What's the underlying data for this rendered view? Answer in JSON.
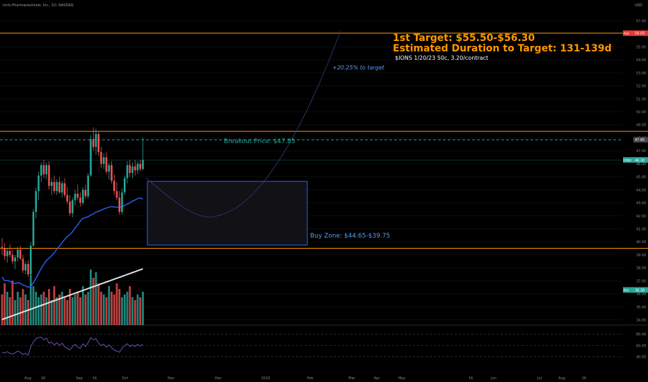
{
  "header": {
    "symbol_line": "Ionis Pharmaceuticals, Inc., 1D, NASDAQ",
    "currency": "USD"
  },
  "annotations": {
    "target_line1": "1st Target: $55.50-$56.30",
    "target_line2": "Estimated Duration to Target: 131-139d",
    "option_note": "$IONS 1/20/23 50c, 3.20/contract",
    "path_note": "+20.25% to target",
    "breakout_label": "Breakout Price: $47.85",
    "buyzone_label": "Buy Zone: $44.65-$39.75"
  },
  "price_badges": [
    {
      "text": "Ask",
      "value": "56.05",
      "price": 56.05,
      "color": "#e53935"
    },
    {
      "text": "",
      "value": "47.85",
      "price": 47.85,
      "color": "#444444"
    },
    {
      "text": "IONS",
      "value": "46.30",
      "price": 46.3,
      "color": "#26a69a"
    },
    {
      "text": "Bid",
      "value": "36.30",
      "price": 36.3,
      "color": "#26a69a"
    }
  ],
  "colors": {
    "bull": "#26a69a",
    "bear": "#ef5350",
    "level": "#ff9800",
    "ma_blue": "#2962ff",
    "ma_white": "#e0e0e0",
    "annotation_blue": "#5b9cf6",
    "breakout_green": "#26a69a"
  },
  "chart_data": {
    "type": "candlestick",
    "title": "Ionis Pharmaceuticals, Inc., 1D, NASDAQ",
    "ylim": [
      33.6,
      58.6
    ],
    "y_ticks": [
      "57.00",
      "56.00",
      "55.00",
      "54.00",
      "53.00",
      "52.00",
      "51.00",
      "50.00",
      "49.00",
      "48.00",
      "47.00",
      "46.00",
      "45.00",
      "44.00",
      "43.00",
      "42.00",
      "41.00",
      "40.00",
      "39.00",
      "38.00",
      "37.00",
      "36.00",
      "35.00",
      "34.00"
    ],
    "x_ticks": [
      "Aug",
      "16",
      "Sep",
      "16",
      "Oct",
      "Nov",
      "Dec",
      "2023",
      "Feb",
      "Mar",
      "Apr",
      "May",
      "16",
      "Jun",
      "Jul",
      "Aug",
      "16"
    ],
    "levels": [
      56.05,
      48.5,
      47.85,
      46.3,
      39.5
    ],
    "buy_zone": {
      "top": 44.65,
      "bottom": 39.75
    },
    "candles": [
      [
        39.6,
        40.3,
        39.0,
        39.5
      ],
      [
        39.5,
        39.9,
        38.6,
        38.9
      ],
      [
        38.9,
        39.5,
        38.4,
        39.3
      ],
      [
        39.3,
        39.8,
        38.8,
        39.0
      ],
      [
        39.0,
        39.4,
        38.3,
        38.5
      ],
      [
        38.5,
        39.0,
        37.9,
        38.8
      ],
      [
        38.8,
        39.6,
        38.5,
        39.4
      ],
      [
        39.4,
        39.7,
        38.6,
        38.7
      ],
      [
        38.7,
        39.0,
        37.6,
        37.8
      ],
      [
        37.8,
        38.5,
        37.5,
        38.3
      ],
      [
        38.3,
        38.6,
        37.3,
        37.5
      ],
      [
        37.5,
        40.0,
        37.3,
        39.7
      ],
      [
        39.7,
        42.5,
        39.6,
        42.3
      ],
      [
        42.3,
        44.2,
        41.8,
        43.9
      ],
      [
        43.9,
        45.4,
        43.2,
        45.1
      ],
      [
        45.1,
        46.1,
        44.6,
        45.9
      ],
      [
        45.9,
        46.3,
        44.9,
        45.2
      ],
      [
        45.2,
        46.1,
        44.8,
        45.9
      ],
      [
        45.9,
        46.2,
        44.0,
        44.3
      ],
      [
        44.3,
        44.9,
        43.6,
        44.6
      ],
      [
        44.6,
        45.1,
        43.7,
        43.9
      ],
      [
        43.9,
        44.8,
        43.6,
        44.6
      ],
      [
        44.6,
        45.0,
        43.7,
        43.8
      ],
      [
        43.8,
        44.7,
        43.4,
        44.5
      ],
      [
        44.5,
        44.9,
        43.4,
        43.6
      ],
      [
        43.6,
        44.2,
        42.9,
        43.1
      ],
      [
        43.1,
        43.6,
        42.0,
        42.2
      ],
      [
        42.2,
        43.4,
        41.9,
        43.2
      ],
      [
        43.2,
        44.0,
        42.8,
        43.7
      ],
      [
        43.7,
        44.4,
        43.2,
        43.4
      ],
      [
        43.4,
        43.8,
        42.7,
        43.0
      ],
      [
        43.0,
        44.2,
        42.8,
        44.0
      ],
      [
        44.0,
        44.4,
        43.3,
        43.5
      ],
      [
        43.5,
        45.3,
        43.3,
        45.1
      ],
      [
        45.1,
        48.2,
        45.0,
        47.9
      ],
      [
        47.9,
        48.8,
        47.0,
        47.3
      ],
      [
        47.3,
        48.7,
        46.7,
        48.3
      ],
      [
        48.3,
        48.5,
        46.6,
        46.9
      ],
      [
        46.9,
        47.3,
        45.7,
        46.0
      ],
      [
        46.0,
        46.8,
        45.6,
        46.5
      ],
      [
        46.5,
        46.9,
        45.2,
        45.4
      ],
      [
        45.4,
        46.1,
        44.8,
        45.9
      ],
      [
        45.9,
        46.2,
        44.5,
        44.7
      ],
      [
        44.7,
        45.2,
        43.6,
        43.9
      ],
      [
        43.9,
        44.6,
        43.2,
        43.4
      ],
      [
        43.4,
        43.9,
        42.1,
        42.3
      ],
      [
        42.3,
        44.1,
        42.1,
        43.8
      ],
      [
        43.8,
        45.1,
        43.6,
        44.9
      ],
      [
        44.9,
        46.2,
        44.5,
        45.9
      ],
      [
        45.9,
        46.3,
        45.0,
        45.3
      ],
      [
        45.3,
        46.1,
        44.9,
        45.8
      ],
      [
        45.8,
        46.3,
        45.1,
        45.5
      ],
      [
        45.5,
        46.2,
        45.2,
        46.0
      ],
      [
        46.0,
        46.3,
        45.4,
        45.6
      ],
      [
        45.6,
        48.0,
        45.5,
        46.3
      ]
    ],
    "volume": [
      0.55,
      0.75,
      0.6,
      0.5,
      0.8,
      0.45,
      0.6,
      0.5,
      0.65,
      0.55,
      0.45,
      0.9,
      0.7,
      0.6,
      0.5,
      0.55,
      0.6,
      0.5,
      0.65,
      0.45,
      0.7,
      0.5,
      0.55,
      0.6,
      0.5,
      0.45,
      0.65,
      0.5,
      0.55,
      0.6,
      0.5,
      0.7,
      0.55,
      0.6,
      1.0,
      0.85,
      0.95,
      0.75,
      0.6,
      0.55,
      0.5,
      0.7,
      0.6,
      0.55,
      0.75,
      0.65,
      0.5,
      0.55,
      0.6,
      0.7,
      0.5,
      0.45,
      0.55,
      0.5,
      0.6
    ],
    "rsi_ticks": [
      "80.00",
      "60.00",
      "40.00"
    ],
    "rsi": [
      48,
      47,
      49,
      46,
      45,
      47,
      50,
      48,
      44,
      46,
      43,
      58,
      66,
      72,
      74,
      75,
      70,
      73,
      64,
      66,
      61,
      65,
      60,
      64,
      58,
      55,
      52,
      58,
      62,
      57,
      55,
      63,
      58,
      65,
      74,
      70,
      72,
      64,
      60,
      62,
      57,
      61,
      56,
      52,
      50,
      48,
      55,
      60,
      63,
      58,
      61,
      58,
      62,
      59,
      62
    ]
  }
}
